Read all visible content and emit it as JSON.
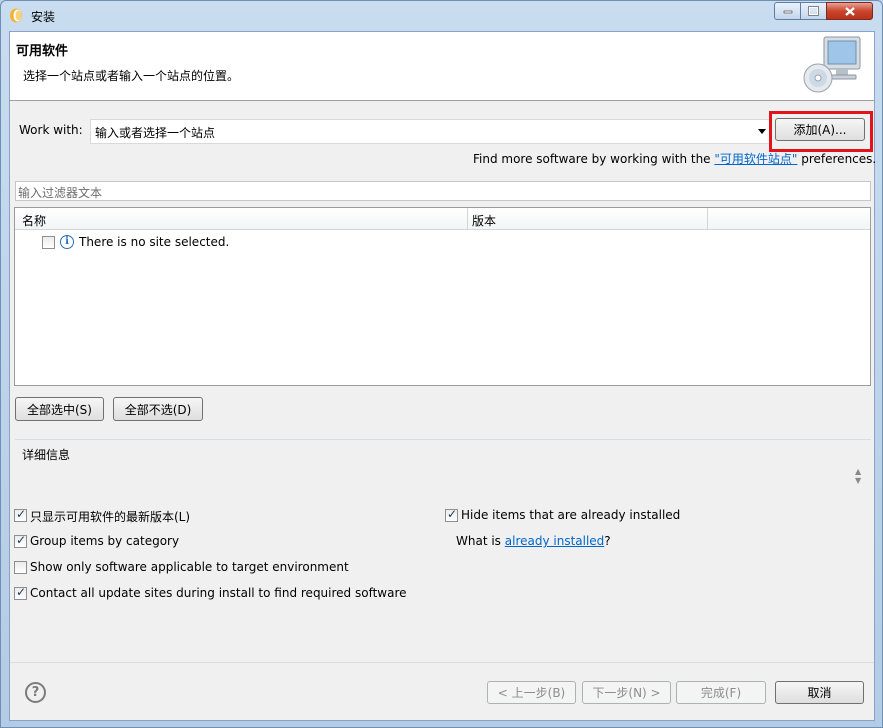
{
  "window": {
    "title": "安装"
  },
  "banner": {
    "title": "可用软件",
    "description": "选择一个站点或者输入一个站点的位置。"
  },
  "work_with": {
    "label": "Work with:",
    "combo_value": "输入或者选择一个站点",
    "add_button": "添加(A)..."
  },
  "find_more": {
    "prefix": "Find more software by working with the ",
    "link": "\"可用软件站点\"",
    "suffix": " preferences."
  },
  "filter": {
    "placeholder": "输入过滤器文本"
  },
  "table": {
    "columns": [
      "名称",
      "版本"
    ],
    "rows": [
      {
        "checked": false,
        "icon": "info-icon",
        "text": "There is no site selected."
      }
    ]
  },
  "selection_buttons": {
    "select_all": "全部选中(S)",
    "deselect_all": "全部不选(D)"
  },
  "details": {
    "label": "详细信息"
  },
  "options": {
    "show_latest": {
      "checked": true,
      "label": "只显示可用软件的最新版本(L)"
    },
    "group_by_category": {
      "checked": true,
      "label": "Group items by category"
    },
    "show_applicable": {
      "checked": false,
      "label": "Show only software applicable to target environment"
    },
    "contact_all": {
      "checked": true,
      "label": "Contact all update sites during install to find required software"
    },
    "hide_installed": {
      "checked": true,
      "label": "Hide items that are already installed"
    },
    "what_is_prefix": "What is ",
    "what_is_link": "already installed",
    "what_is_suffix": "?"
  },
  "footer": {
    "back": "< 上一步(B)",
    "next": "下一步(N) >",
    "finish": "完成(F)",
    "cancel": "取消"
  },
  "colors": {
    "highlight": "#e3131b",
    "link": "#0066cc"
  }
}
